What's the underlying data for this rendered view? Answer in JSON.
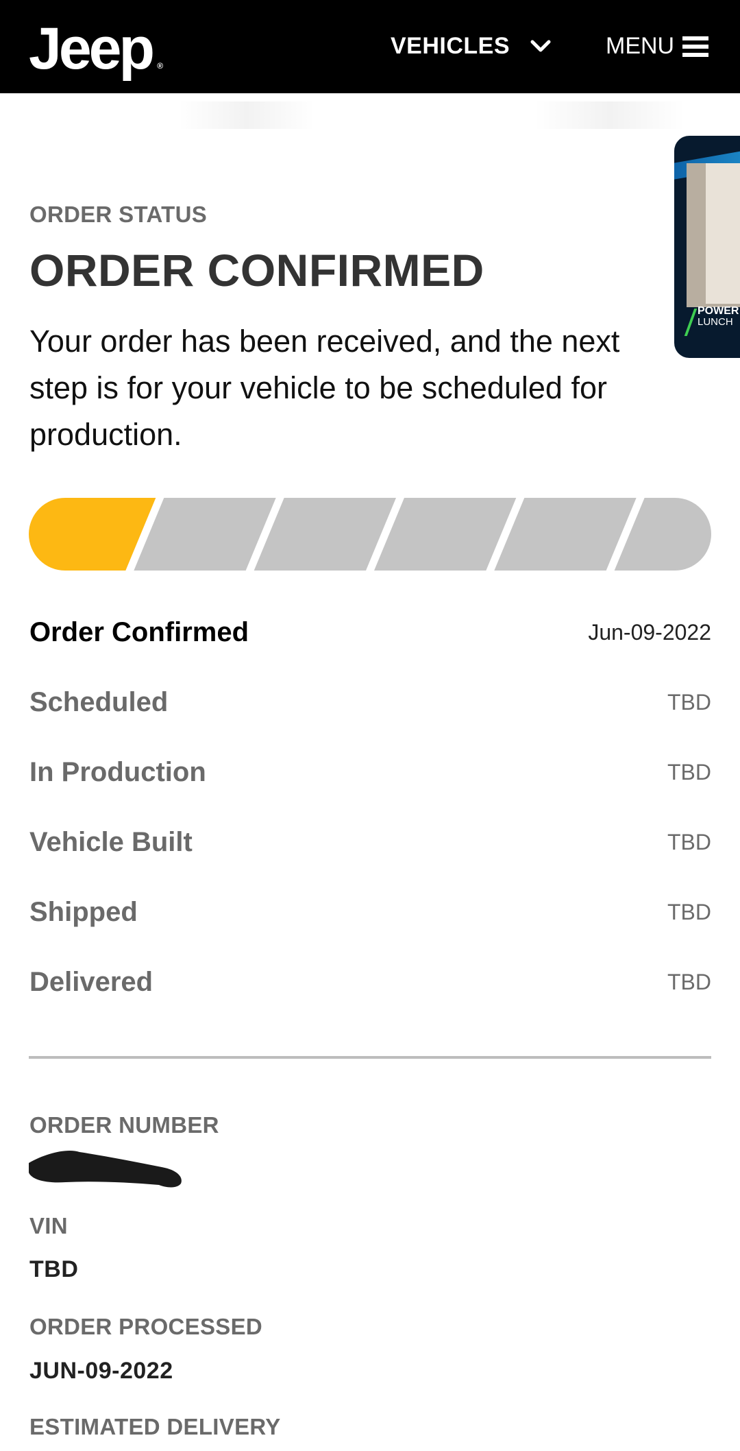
{
  "header": {
    "logo_text": "Jeep",
    "logo_mark": "®",
    "vehicles_label": "VEHICLES",
    "menu_label": "MENU"
  },
  "pip_video": {
    "badge_line1": "POWER",
    "badge_line2": "LUNCH"
  },
  "order_status": {
    "section_label": "ORDER STATUS",
    "title": "ORDER CONFIRMED",
    "description": "Your order has been received, and the next step is for your vehicle to be scheduled for production.",
    "progress": {
      "completed_steps": 1,
      "total_steps": 6
    },
    "steps": [
      {
        "label": "Order Confirmed",
        "date": "Jun-09-2022",
        "active": true
      },
      {
        "label": "Scheduled",
        "date": "TBD",
        "active": false
      },
      {
        "label": "In Production",
        "date": "TBD",
        "active": false
      },
      {
        "label": "Vehicle Built",
        "date": "TBD",
        "active": false
      },
      {
        "label": "Shipped",
        "date": "TBD",
        "active": false
      },
      {
        "label": "Delivered",
        "date": "TBD",
        "active": false
      }
    ]
  },
  "details": {
    "order_number_label": "ORDER NUMBER",
    "vin_label": "VIN",
    "vin_value": "TBD",
    "processed_label": "ORDER PROCESSED",
    "processed_value": "JUN-09-2022",
    "estimated_delivery_label": "ESTIMATED DELIVERY"
  },
  "colors": {
    "progress_active": "#FDB813",
    "progress_inactive": "#C4C4C4",
    "header_bg": "#000000"
  }
}
